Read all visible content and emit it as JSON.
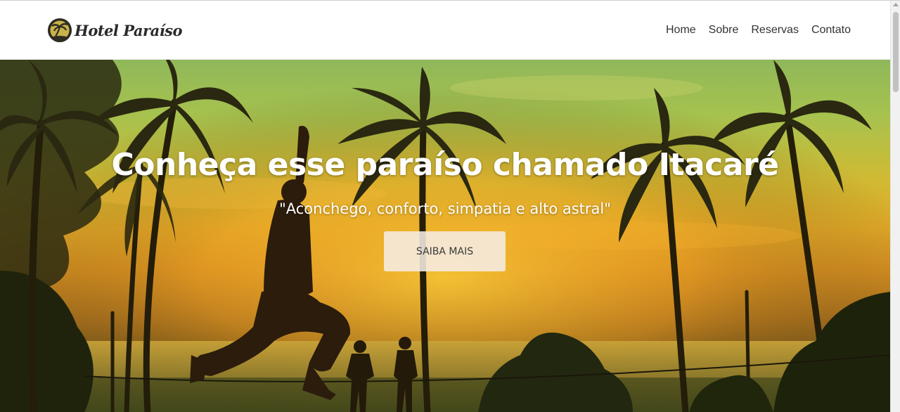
{
  "header": {
    "brand": "Hotel Paraíso",
    "logo_icon": "palm-tree-logo-icon",
    "nav": [
      {
        "label": "Home"
      },
      {
        "label": "Sobre"
      },
      {
        "label": "Reservas"
      },
      {
        "label": "Contato"
      }
    ]
  },
  "hero": {
    "title": "Conheça esse paraíso chamado Itacaré",
    "subtitle": "\"Aconchego, conforto, simpatia e alto astral\"",
    "cta_label": "SAIBA MAIS",
    "background": "sunset-palm-beach-photo"
  },
  "colors": {
    "nav_text": "#333333",
    "hero_text": "#ffffff",
    "cta_bg": "#f5ece2"
  }
}
